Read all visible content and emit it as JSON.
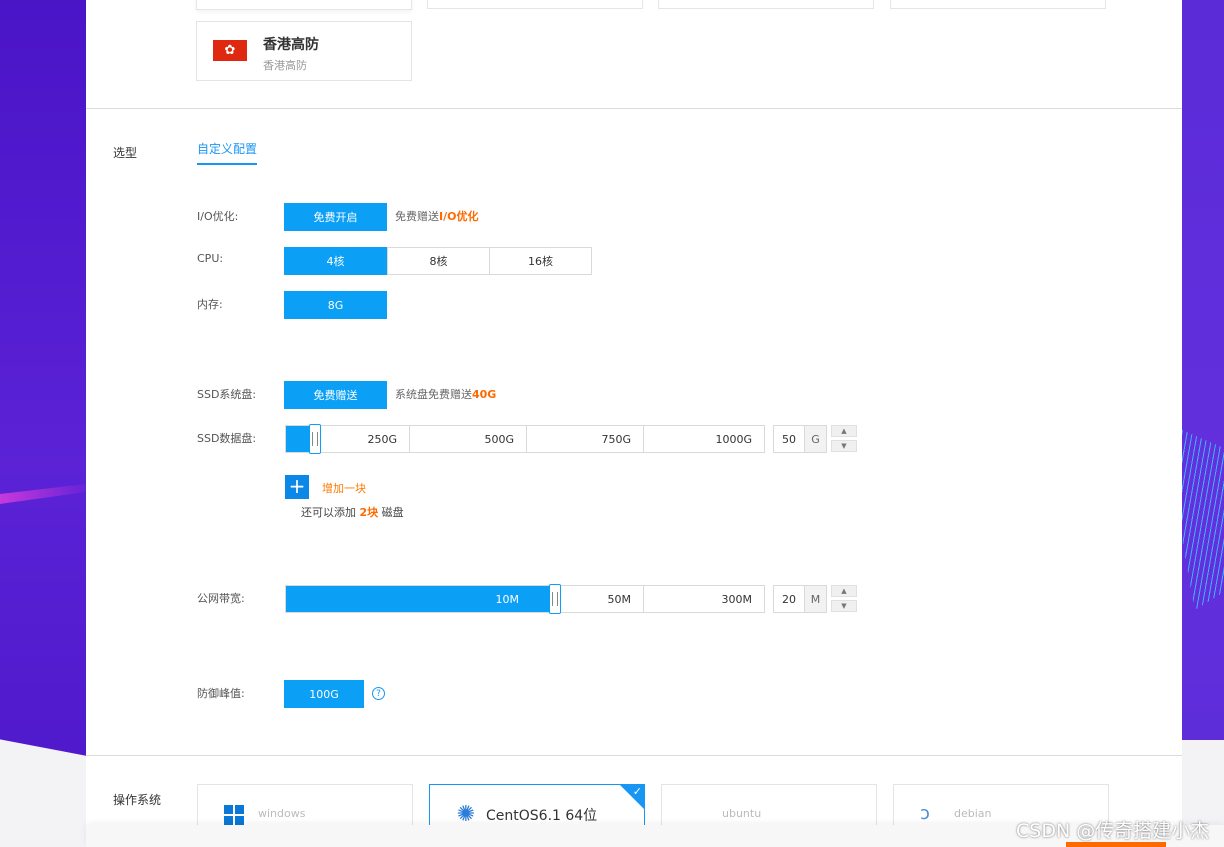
{
  "region": {
    "title": "香港高防",
    "subtitle": "香港高防",
    "flag_icon": "hk-flag-icon"
  },
  "model": {
    "section_label": "选型",
    "tab_label": "自定义配置"
  },
  "io": {
    "label": "I/O优化:",
    "button": "免费开启",
    "note_prefix": "免费赠送",
    "note_highlight": "I/O优化"
  },
  "cpu": {
    "label": "CPU:",
    "options": [
      "4核",
      "8核",
      "16核"
    ],
    "selected": "4核"
  },
  "memory": {
    "label": "内存:",
    "options": [
      "8G"
    ],
    "selected": "8G"
  },
  "ssd_system": {
    "label": "SSD系统盘:",
    "button": "免费赠送",
    "note_prefix": "系统盘免费赠送",
    "note_highlight": "40G"
  },
  "ssd_data": {
    "label": "SSD数据盘:",
    "ticks": [
      "250G",
      "500G",
      "750G",
      "1000G"
    ],
    "value": "50",
    "unit": "G",
    "add_label": "增加一块",
    "remaining_prefix": "还可以添加",
    "remaining_count": "2块",
    "remaining_suffix": "磁盘"
  },
  "bandwidth": {
    "label": "公网带宽:",
    "ticks": [
      "10M",
      "50M",
      "300M"
    ],
    "value": "20",
    "unit": "M"
  },
  "defense": {
    "label": "防御峰值:",
    "button": "100G",
    "help_icon": "question-icon"
  },
  "os": {
    "section_label": "操作系统",
    "options": [
      {
        "name": "windows",
        "icon": "windows-icon"
      },
      {
        "name": "CentOS6.1 64位",
        "icon": "centos-icon"
      },
      {
        "name": "ubuntu",
        "icon": ""
      },
      {
        "name": "debian",
        "icon": "debian-icon"
      }
    ],
    "selected": "CentOS6.1 64位"
  },
  "watermark": "CSDN @传奇搭建小杰",
  "colors": {
    "primary": "#0b9ff5",
    "accent": "#ff6a00",
    "tab": "#1896f3"
  }
}
